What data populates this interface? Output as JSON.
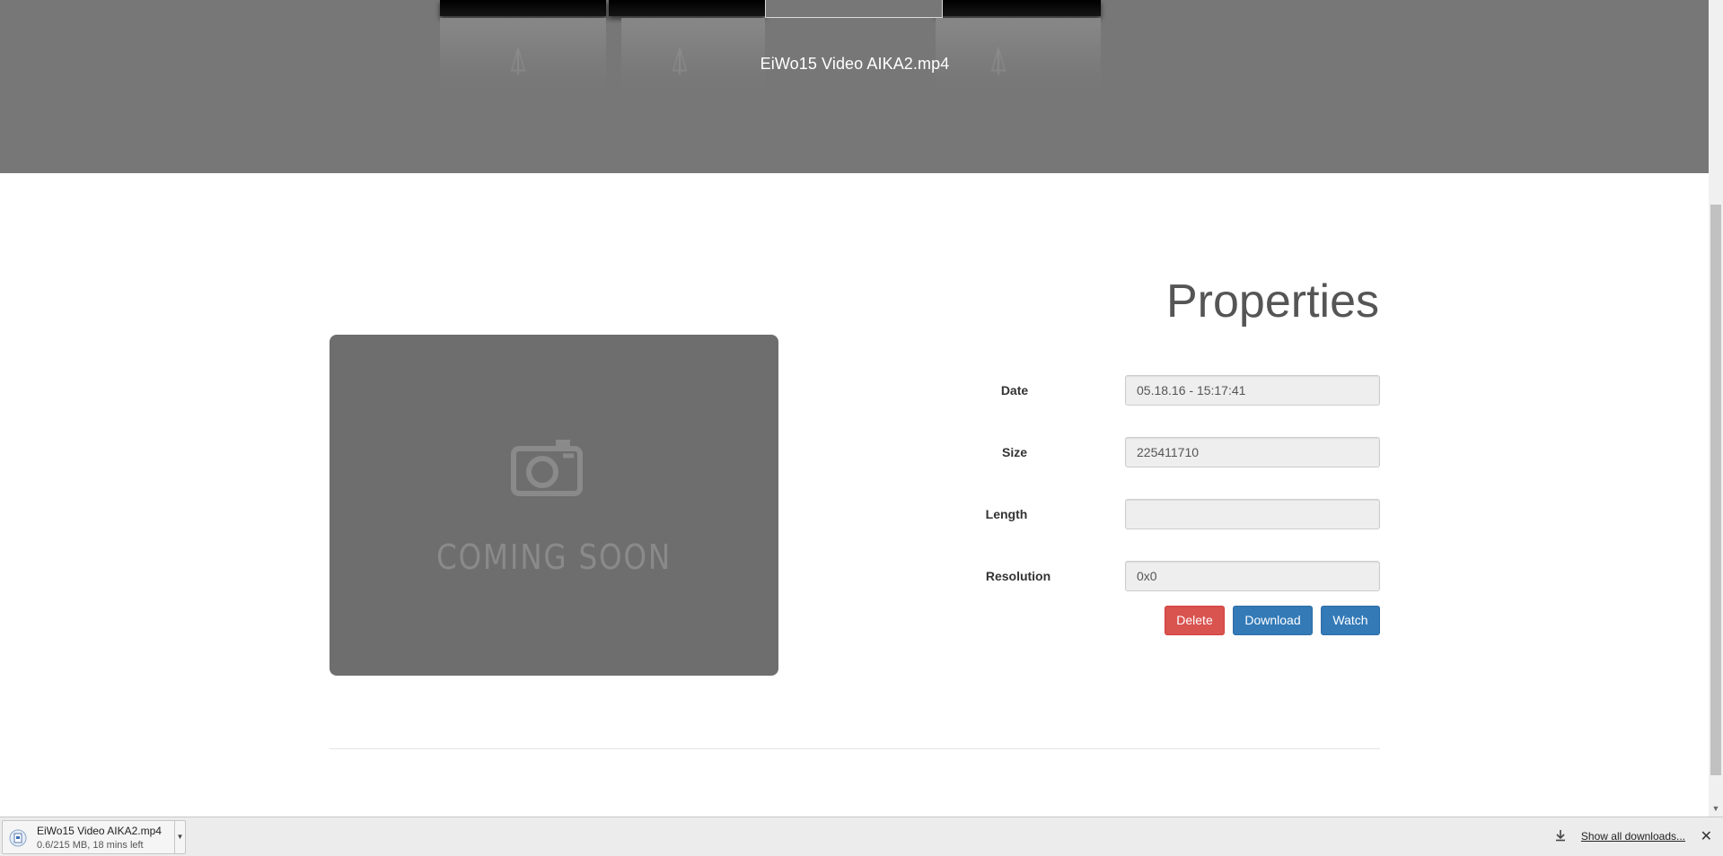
{
  "hero": {
    "video_title": "EiWo15 Video AIKA2.mp4"
  },
  "thumbnail": {
    "placeholder_text": "COMING SOON",
    "icon": "camera-icon"
  },
  "properties": {
    "title": "Properties",
    "fields": [
      {
        "label": "Date",
        "value": "05.18.16 - 15:17:41"
      },
      {
        "label": "Size",
        "value": "225411710"
      },
      {
        "label": "Length",
        "value": ""
      },
      {
        "label": "Resolution",
        "value": "0x0"
      }
    ]
  },
  "actions": {
    "delete_label": "Delete",
    "download_label": "Download",
    "watch_label": "Watch"
  },
  "colors": {
    "hero_bg": "#777777",
    "danger": "#d9534f",
    "primary": "#337ab7"
  },
  "download_bar": {
    "file_name": "EiWo15 Video AIKA2.mp4",
    "status": "0.6/215 MB, 18 mins left",
    "show_all_label": "Show all downloads...",
    "close_icon": "close-icon"
  }
}
